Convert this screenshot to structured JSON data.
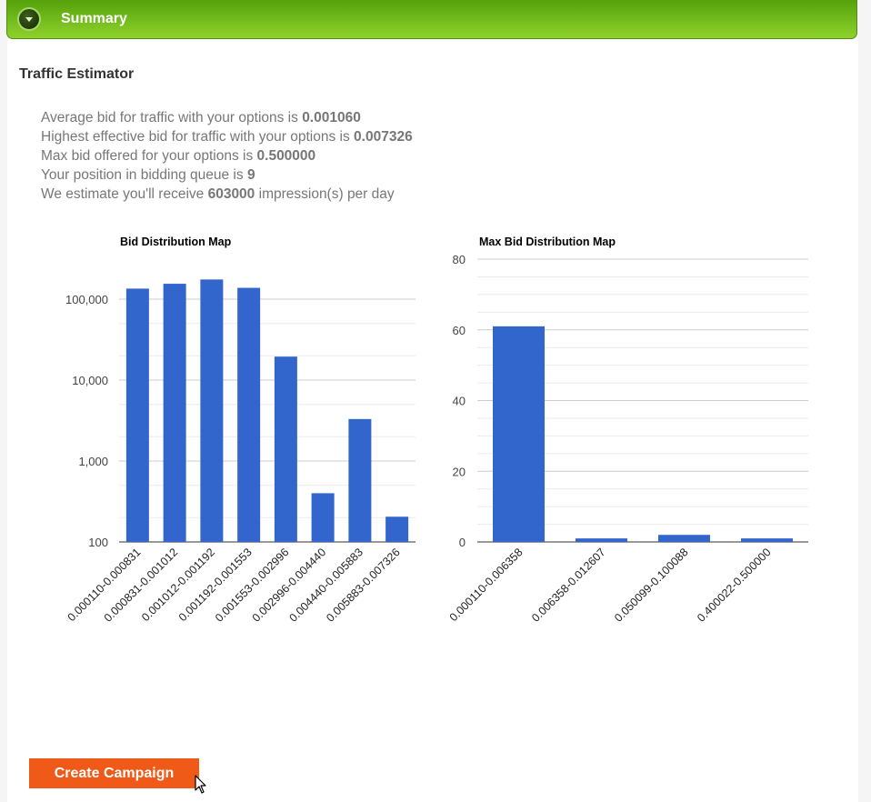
{
  "header": {
    "title": "Summary",
    "toggle_icon": "chevron-down-icon"
  },
  "traffic": {
    "heading": "Traffic Estimator",
    "lines": [
      {
        "before": "Average bid for traffic with your options is ",
        "value": "0.001060",
        "after": ""
      },
      {
        "before": "Highest effective bid for traffic with your options is ",
        "value": "0.007326",
        "after": ""
      },
      {
        "before": "Max bid offered for your options is ",
        "value": "0.500000",
        "after": ""
      },
      {
        "before": "Your position in bidding queue is ",
        "value": "9",
        "after": ""
      },
      {
        "before": "We estimate you'll receive ",
        "value": "603000",
        "after": " impression(s) per day"
      }
    ]
  },
  "chart_data": [
    {
      "type": "bar",
      "title": "Bid Distribution Map",
      "yscale": "log",
      "ylim": [
        100,
        200000
      ],
      "yticks": [
        "100",
        "1,000",
        "10,000",
        "100,000"
      ],
      "grid": true,
      "bar_color": "#3366cc",
      "categories": [
        "0.000110-0.000831",
        "0.000831-0.001012",
        "0.001012-0.001192",
        "0.001192-0.001553",
        "0.001553-0.002996",
        "0.002996-0.004440",
        "0.004440-0.005883",
        "0.005883-0.007326"
      ],
      "values": [
        135000,
        155000,
        175000,
        138000,
        19500,
        400,
        3300,
        205
      ]
    },
    {
      "type": "bar",
      "title": "Max Bid Distribution Map",
      "yscale": "linear",
      "ylim": [
        0,
        80
      ],
      "yticks": [
        "0",
        "20",
        "40",
        "60",
        "80"
      ],
      "grid": true,
      "bar_color": "#3366cc",
      "categories": [
        "0.000110-0.006358",
        "0.006358-0.012607",
        "0.050099-0.100088",
        "0.400022-0.500000"
      ],
      "values": [
        61,
        1,
        2,
        1
      ]
    }
  ],
  "actions": {
    "create_campaign": "Create Campaign"
  }
}
